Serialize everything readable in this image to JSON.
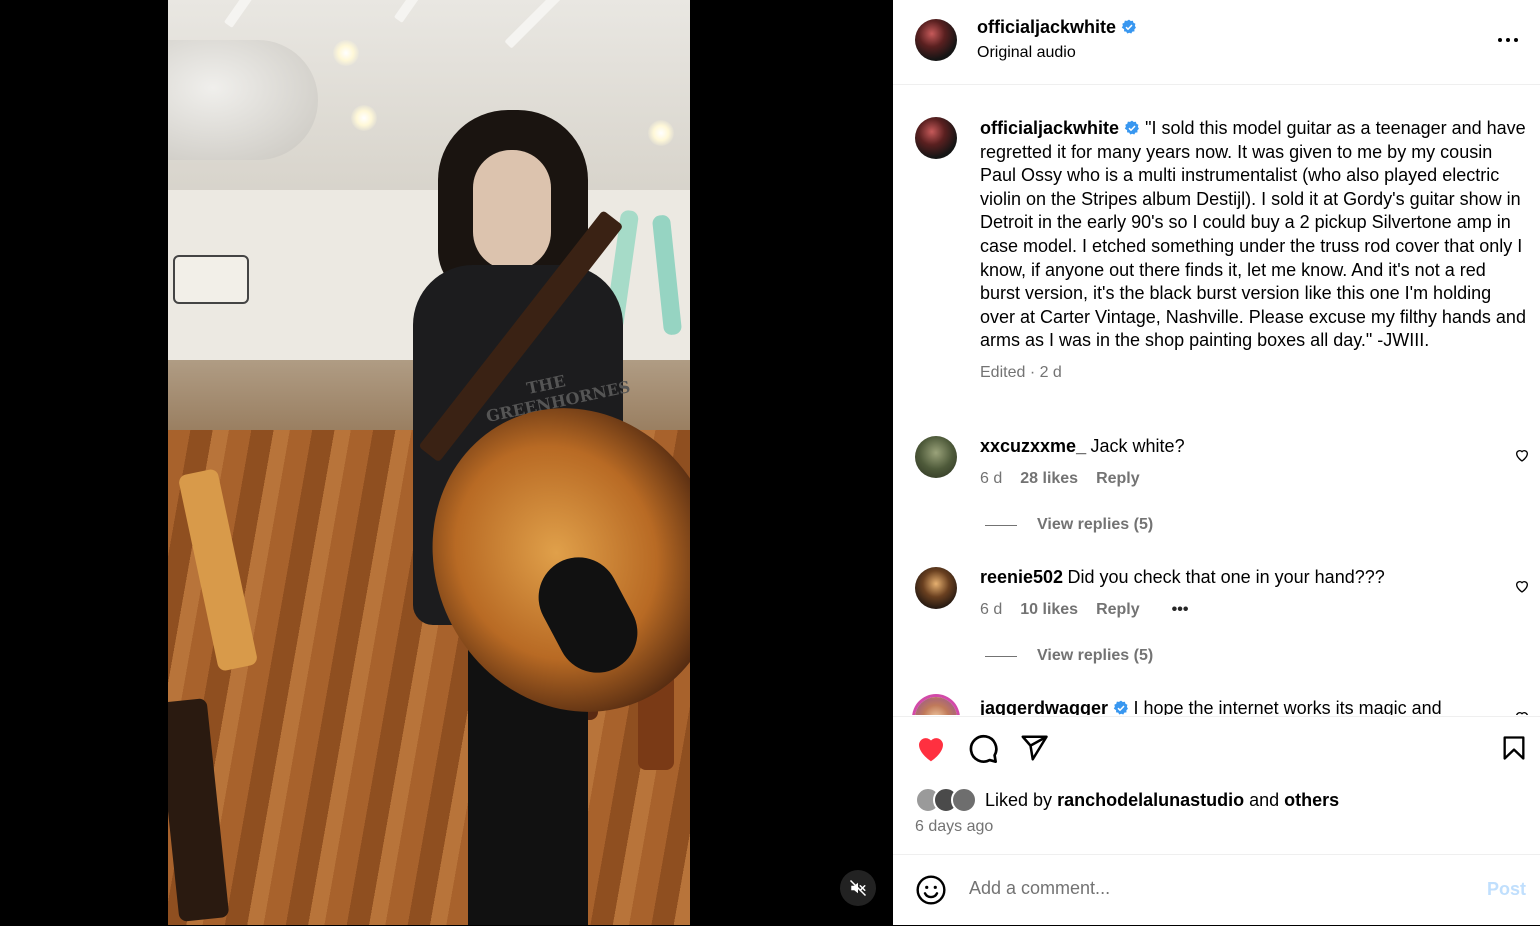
{
  "post": {
    "username": "officialjackwhite",
    "audio_label": "Original audio",
    "caption": "\"I sold this model guitar as a teenager and have regretted it for many years now. It was given to me by my cousin Paul Ossy who is a multi instrumentalist (who also played electric violin on the Stripes album Destijl). I sold it at Gordy's guitar show in Detroit in the early 90's so I could buy a 2 pickup Silvertone amp in case model. I etched something under the truss rod cover that only I know, if anyone out there finds it, let me know. And it's not a red burst version, it's the black burst version like this one I'm holding over at Carter Vintage, Nashville. Please excuse my filthy hands and arms as I was in the shop painting boxes all day.\" -JWIII.",
    "caption_meta": "Edited · 2 d"
  },
  "media": {
    "shirt_text": "THE GREENHORNES",
    "mute_icon": "speaker-muted-icon"
  },
  "comments": [
    {
      "username": "xxcuzxxme_",
      "text": "Jack white?",
      "age": "6 d",
      "likes": "28 likes",
      "reply_label": "Reply",
      "view_replies": "View replies (5)"
    },
    {
      "username": "reenie502",
      "text": "Did you check that one in your hand???",
      "age": "6 d",
      "likes": "10 likes",
      "reply_label": "Reply",
      "more": "•••",
      "view_replies": "View replies (5)"
    },
    {
      "username": "jaggerdwagger",
      "text": "I hope the internet works its magic and"
    }
  ],
  "likes": {
    "prefix": "Liked by",
    "liker": "ranchodelalunastudio",
    "conjunction": "and",
    "others": "others",
    "time_ago": "6 days ago"
  },
  "composer": {
    "placeholder": "Add a comment...",
    "post_label": "Post"
  },
  "colors": {
    "like_red": "#ff3040",
    "verified_blue": "#3897f0",
    "post_disabled": "#c0dffd",
    "secondary_text": "#737373"
  }
}
